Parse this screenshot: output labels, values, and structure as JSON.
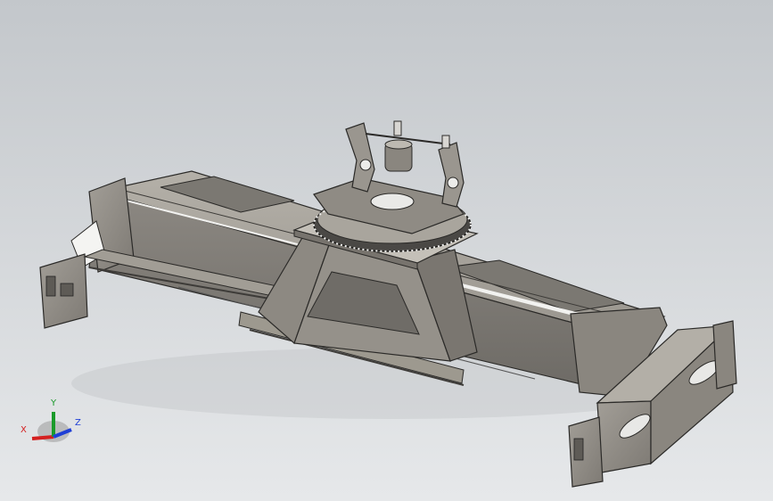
{
  "viewport": {
    "background_top": "#c3c7cb",
    "background_bottom": "#e6e8ea",
    "model_name": ""
  },
  "colors": {
    "steel_light": "#a8a49c",
    "steel_mid": "#8f8b84",
    "steel_dark": "#5e5b56",
    "edge": "#2b2a28",
    "highlight": "#f2f2f0"
  },
  "triad": {
    "x_label": "X",
    "y_label": "Y",
    "z_label": "Z",
    "x_color": "#d42020",
    "y_color": "#1a9a2a",
    "z_color": "#1f3fd6"
  }
}
